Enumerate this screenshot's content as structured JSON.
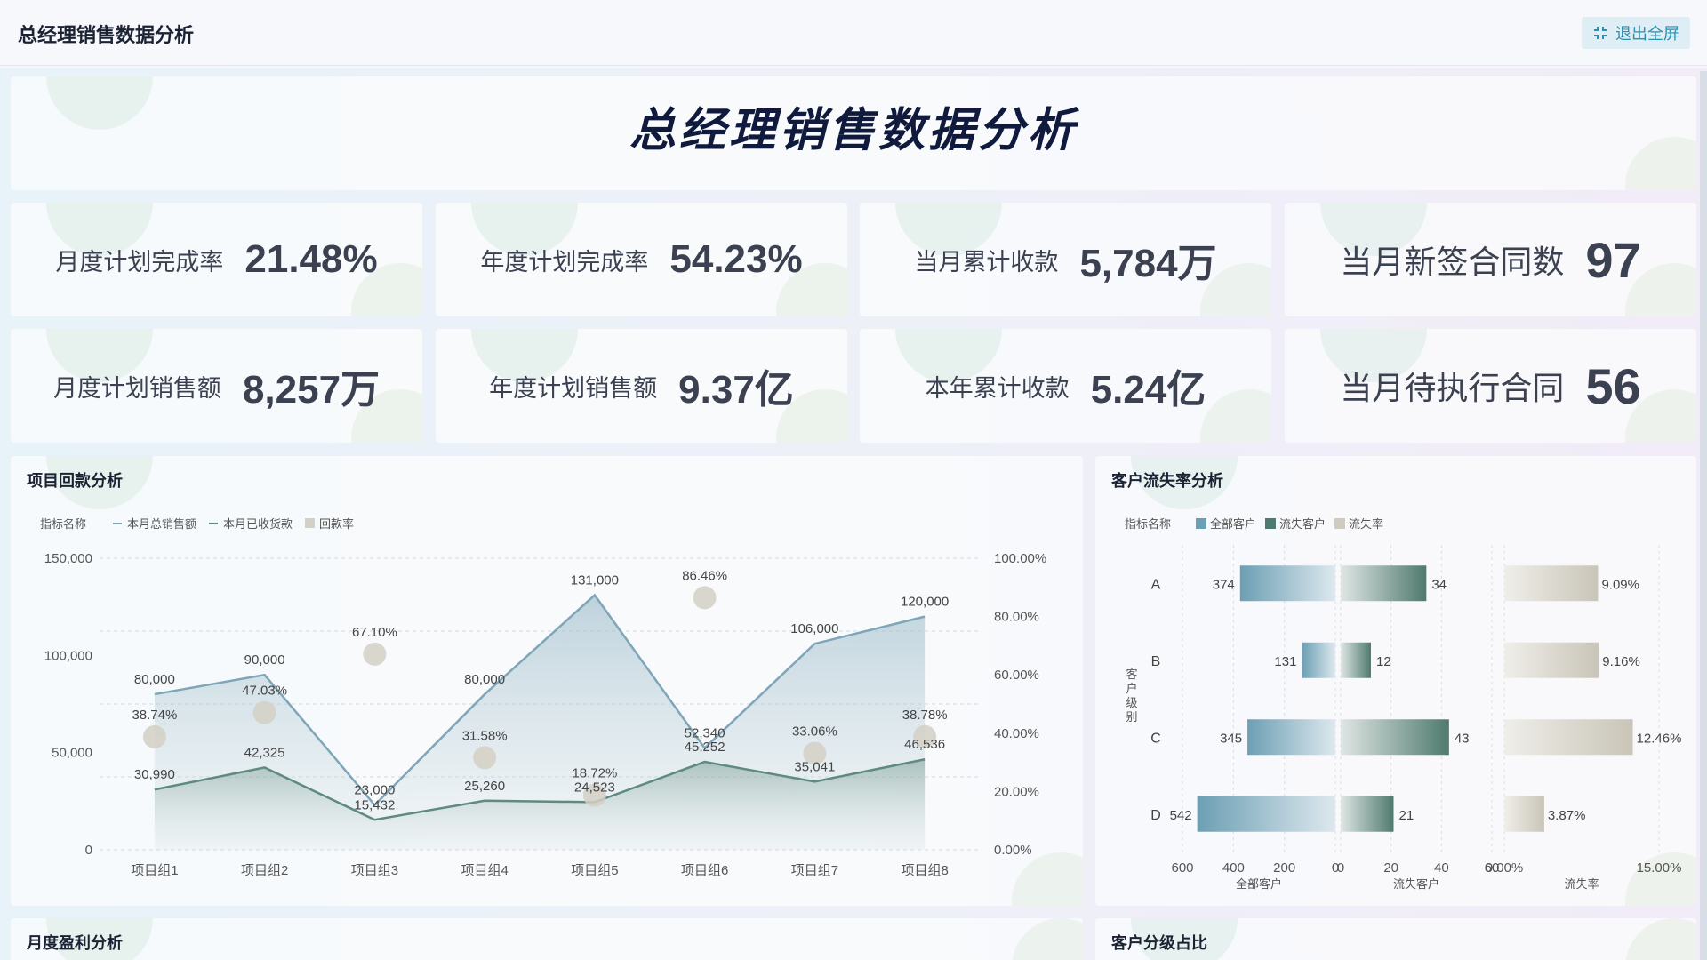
{
  "app": {
    "title": "总经理销售数据分析",
    "exit_label": "退出全屏",
    "exit_icon": "collapse-icon"
  },
  "banner": {
    "title": "总经理销售数据分析"
  },
  "kpis": [
    {
      "label": "月度计划完成率",
      "value": "21.48%"
    },
    {
      "label": "年度计划完成率",
      "value": "54.23%"
    },
    {
      "label": "当月累计收款",
      "value": "5,784万"
    },
    {
      "label": "当月新签合同数",
      "value": "97"
    },
    {
      "label": "月度计划销售额",
      "value": "8,257万"
    },
    {
      "label": "年度计划销售额",
      "value": "9.37亿"
    },
    {
      "label": "本年累计收款",
      "value": "5.24亿"
    },
    {
      "label": "当月待执行合同",
      "value": "56"
    }
  ],
  "panels": {
    "project": {
      "title": "项目回款分析"
    },
    "churn": {
      "title": "客户流失率分析"
    },
    "monthly": {
      "title": "月度盈利分析"
    },
    "grade": {
      "title": "客户分级占比"
    }
  },
  "chart_data": [
    {
      "type": "area",
      "title": "项目回款分析",
      "legend_title": "指标名称",
      "categories": [
        "项目组1",
        "项目组2",
        "项目组3",
        "项目组4",
        "项目组5",
        "项目组6",
        "项目组7",
        "项目组8"
      ],
      "series": [
        {
          "name": "本月总销售额",
          "values": [
            80000,
            90000,
            23000,
            80000,
            131000,
            52340,
            106000,
            120000
          ],
          "labels": [
            "80,000",
            "90,000",
            "23,000",
            "80,000",
            "131,000",
            "52,340",
            "106,000",
            "120,000"
          ],
          "color": "#7fa6b8",
          "axis": "left"
        },
        {
          "name": "本月已收货款",
          "values": [
            30990,
            42325,
            15432,
            25260,
            24523,
            45252,
            35041,
            46536
          ],
          "labels": [
            "30,990",
            "42,325",
            "15,432",
            "25,260",
            "24,523",
            "45,252",
            "35,041",
            "46,536"
          ],
          "color": "#5f8a80",
          "axis": "left"
        },
        {
          "name": "回款率",
          "values": [
            38.74,
            47.03,
            67.1,
            31.58,
            18.72,
            86.46,
            33.06,
            38.78
          ],
          "labels": [
            "38.74%",
            "47.03%",
            "67.10%",
            "31.58%",
            "18.72%",
            "86.46%",
            "33.06%",
            "38.78%"
          ],
          "color": "#d3d0c4",
          "axis": "right",
          "kind": "scatter"
        }
      ],
      "ylim": [
        0,
        150000
      ],
      "yticks": [
        "0",
        "50,000",
        "100,000",
        "150,000"
      ],
      "y2lim": [
        0,
        100
      ],
      "y2ticks": [
        "0.00%",
        "20.00%",
        "40.00%",
        "60.00%",
        "80.00%",
        "100.00%"
      ],
      "legend": "top-left",
      "grid": true
    },
    {
      "type": "bar",
      "title": "客户流失率分析",
      "legend_title": "指标名称",
      "categories": [
        "A",
        "B",
        "C",
        "D"
      ],
      "ylabel": "客户级别",
      "series": [
        {
          "name": "全部客户",
          "values": [
            374,
            131,
            345,
            542
          ],
          "xlim": [
            0,
            600
          ],
          "xticks": [
            "600",
            "400",
            "200",
            "0"
          ],
          "xlabel": "全部客户",
          "color": "#6c9fb3"
        },
        {
          "name": "流失客户",
          "values": [
            34,
            12,
            43,
            21
          ],
          "xlim": [
            0,
            60
          ],
          "xticks": [
            "0",
            "20",
            "40",
            "60"
          ],
          "xlabel": "流失客户",
          "color": "#4f7a6e"
        },
        {
          "name": "流失率",
          "values": [
            9.09,
            9.16,
            12.46,
            3.87
          ],
          "labels": [
            "9.09%",
            "9.16%",
            "12.46%",
            "3.87%"
          ],
          "xlim": [
            0,
            15
          ],
          "xticks": [
            "0.00%",
            "15.00%"
          ],
          "xlabel": "流失率",
          "color": "#cfcbbf"
        }
      ],
      "legend": "top-left",
      "grid": true
    }
  ]
}
